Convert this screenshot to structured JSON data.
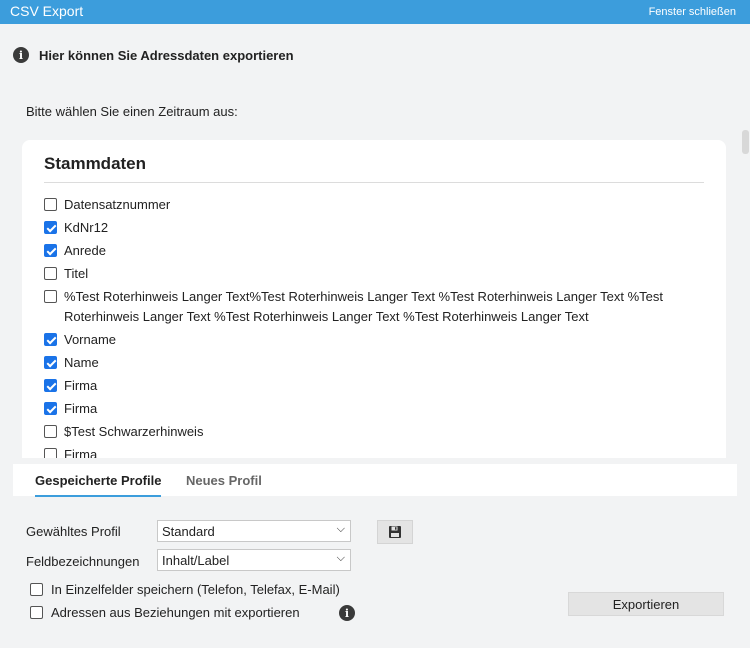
{
  "window": {
    "title": "CSV Export",
    "close_label": "Fenster schließen"
  },
  "header": {
    "info_text": "Hier können Sie Adressdaten exportieren"
  },
  "period_prompt": "Bitte wählen Sie einen Zeitraum aus:",
  "stammdaten": {
    "heading": "Stammdaten",
    "fields": [
      {
        "label": "Datensatznummer",
        "checked": false
      },
      {
        "label": "KdNr12",
        "checked": true
      },
      {
        "label": "Anrede",
        "checked": true
      },
      {
        "label": "Titel",
        "checked": false
      },
      {
        "label": "%Test Roterhinweis Langer Text%Test Roterhinweis Langer Text %Test Roterhinweis Langer Text %Test Roterhinweis Langer Text %Test Roterhinweis Langer Text %Test Roterhinweis Langer Text",
        "checked": false
      },
      {
        "label": "Vorname",
        "checked": true
      },
      {
        "label": "Name",
        "checked": true
      },
      {
        "label": "Firma",
        "checked": true
      },
      {
        "label": "Firma",
        "checked": true
      },
      {
        "label": "$Test Schwarzerhinweis",
        "checked": false
      },
      {
        "label": "Firma",
        "checked": false
      }
    ]
  },
  "tabs": [
    {
      "label": "Gespeicherte Profile",
      "active": true
    },
    {
      "label": "Neues Profil",
      "active": false
    }
  ],
  "form": {
    "profile_label": "Gewähltes Profil",
    "profile_value": "Standard",
    "fieldnames_label": "Feldbezeichnungen",
    "fieldnames_value": "Inhalt/Label",
    "option_single_fields": "In Einzelfelder speichern (Telefon, Telefax, E-Mail)",
    "option_relations": "Adressen aus Beziehungen mit exportieren",
    "export_label": "Exportieren"
  },
  "colors": {
    "accent": "#3c9ddc",
    "checkbox": "#1a73e8"
  }
}
